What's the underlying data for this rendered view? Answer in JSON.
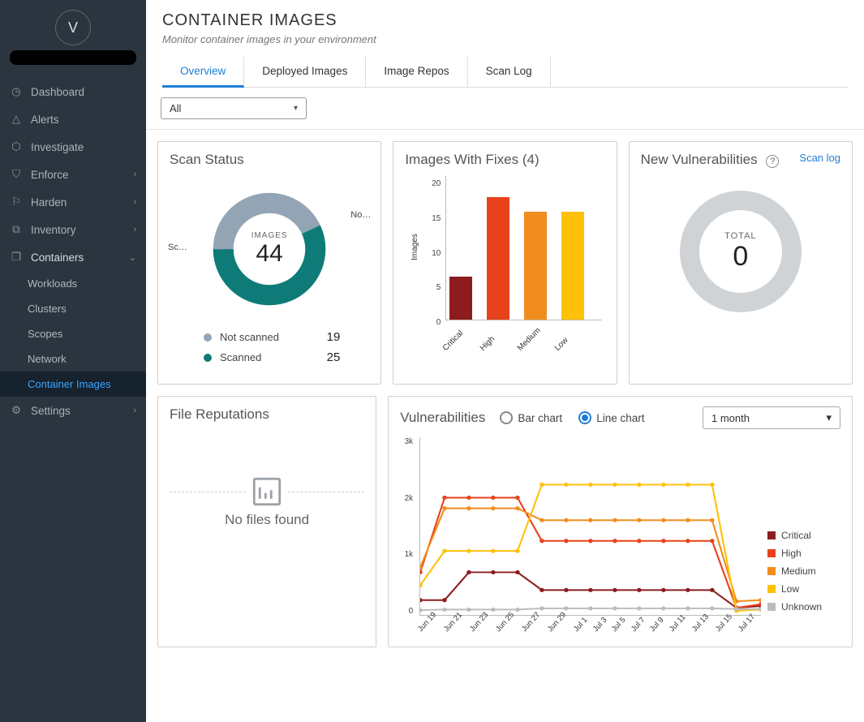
{
  "avatar": "V",
  "sidebar": {
    "items": [
      {
        "icon": "◷",
        "label": "Dashboard",
        "chev": ""
      },
      {
        "icon": "△",
        "label": "Alerts",
        "chev": ""
      },
      {
        "icon": "⬡",
        "label": "Investigate",
        "chev": ""
      },
      {
        "icon": "⛉",
        "label": "Enforce",
        "chev": "›"
      },
      {
        "icon": "⚐",
        "label": "Harden",
        "chev": "›"
      },
      {
        "icon": "⧉",
        "label": "Inventory",
        "chev": "›"
      },
      {
        "icon": "❒",
        "label": "Containers",
        "chev": "⌄"
      },
      {
        "icon": "⚙",
        "label": "Settings",
        "chev": "›"
      }
    ],
    "sub": [
      "Workloads",
      "Clusters",
      "Scopes",
      "Network",
      "Container Images"
    ]
  },
  "header": {
    "title": "CONTAINER IMAGES",
    "subtitle": "Monitor container images in your environment"
  },
  "tabs": [
    "Overview",
    "Deployed Images",
    "Image Repos",
    "Scan Log"
  ],
  "filter": {
    "value": "All"
  },
  "scanStatus": {
    "title": "Scan Status",
    "centerLabel": "IMAGES",
    "total": "44",
    "left": "Sc…",
    "right": "No…",
    "legend": [
      {
        "label": "Not scanned",
        "value": "19",
        "color": "#93a5b4"
      },
      {
        "label": "Scanned",
        "value": "25",
        "color": "#0e7b78"
      }
    ]
  },
  "imagesFixes": {
    "title": "Images With Fixes (4)",
    "ylabel": "Images"
  },
  "newVuln": {
    "title": "New Vulnerabilities",
    "help": "?",
    "link": "Scan log",
    "totalLabel": "TOTAL",
    "total": "0"
  },
  "fileRep": {
    "title": "File Reputations",
    "empty": "No files found"
  },
  "vuln": {
    "title": "Vulnerabilities",
    "radios": [
      "Bar chart",
      "Line chart"
    ],
    "range": "1 month",
    "legend": [
      {
        "label": "Critical",
        "color": "#8c1c1d"
      },
      {
        "label": "High",
        "color": "#e8421c"
      },
      {
        "label": "Medium",
        "color": "#f18d1f"
      },
      {
        "label": "Low",
        "color": "#ffc107"
      },
      {
        "label": "Unknown",
        "color": "#b9bcc0"
      }
    ]
  },
  "chart_data": [
    {
      "type": "pie",
      "title": "Scan Status",
      "categories": [
        "Not scanned",
        "Scanned"
      ],
      "values": [
        19,
        25
      ],
      "colors": [
        "#93a5b4",
        "#0e7b78"
      ],
      "total": 44
    },
    {
      "type": "bar",
      "title": "Images With Fixes (4)",
      "categories": [
        "Critical",
        "High",
        "Medium",
        "Low"
      ],
      "values": [
        6,
        17,
        15,
        15
      ],
      "colors": [
        "#8c1c1d",
        "#e8421c",
        "#f18d1f",
        "#ffc107"
      ],
      "ylabel": "Images",
      "ylim": [
        0,
        20
      ]
    },
    {
      "type": "pie",
      "title": "New Vulnerabilities",
      "categories": [
        "Total"
      ],
      "values": [
        0
      ]
    },
    {
      "type": "line",
      "title": "Vulnerabilities",
      "x": [
        "Jun 19",
        "Jun 21",
        "Jun 23",
        "Jun 25",
        "Jun 27",
        "Jun 29",
        "Jul 1",
        "Jul 3",
        "Jul 5",
        "Jul 7",
        "Jul 9",
        "Jul 11",
        "Jul 13",
        "Jul 15",
        "Jul 17"
      ],
      "series": [
        {
          "name": "Critical",
          "color": "#8c1c1d",
          "values": [
            250,
            250,
            720,
            720,
            720,
            420,
            420,
            420,
            420,
            420,
            420,
            420,
            420,
            120,
            150
          ]
        },
        {
          "name": "High",
          "color": "#e8421c",
          "values": [
            720,
            1980,
            1980,
            1980,
            1980,
            1250,
            1250,
            1250,
            1250,
            1250,
            1250,
            1250,
            1250,
            120,
            180
          ]
        },
        {
          "name": "Medium",
          "color": "#f18d1f",
          "values": [
            800,
            1800,
            1800,
            1800,
            1800,
            1600,
            1600,
            1600,
            1600,
            1600,
            1600,
            1600,
            1600,
            230,
            250
          ]
        },
        {
          "name": "Low",
          "color": "#ffc107",
          "values": [
            500,
            1080,
            1080,
            1080,
            1080,
            2200,
            2200,
            2200,
            2200,
            2200,
            2200,
            2200,
            2200,
            70,
            90
          ]
        },
        {
          "name": "Unknown",
          "color": "#b9bcc0",
          "values": [
            80,
            90,
            90,
            90,
            90,
            110,
            110,
            110,
            110,
            110,
            110,
            110,
            110,
            100,
            100
          ]
        }
      ],
      "ylim": [
        0,
        3000
      ],
      "yticks": [
        "0",
        "1k",
        "2k",
        "3k"
      ]
    }
  ]
}
